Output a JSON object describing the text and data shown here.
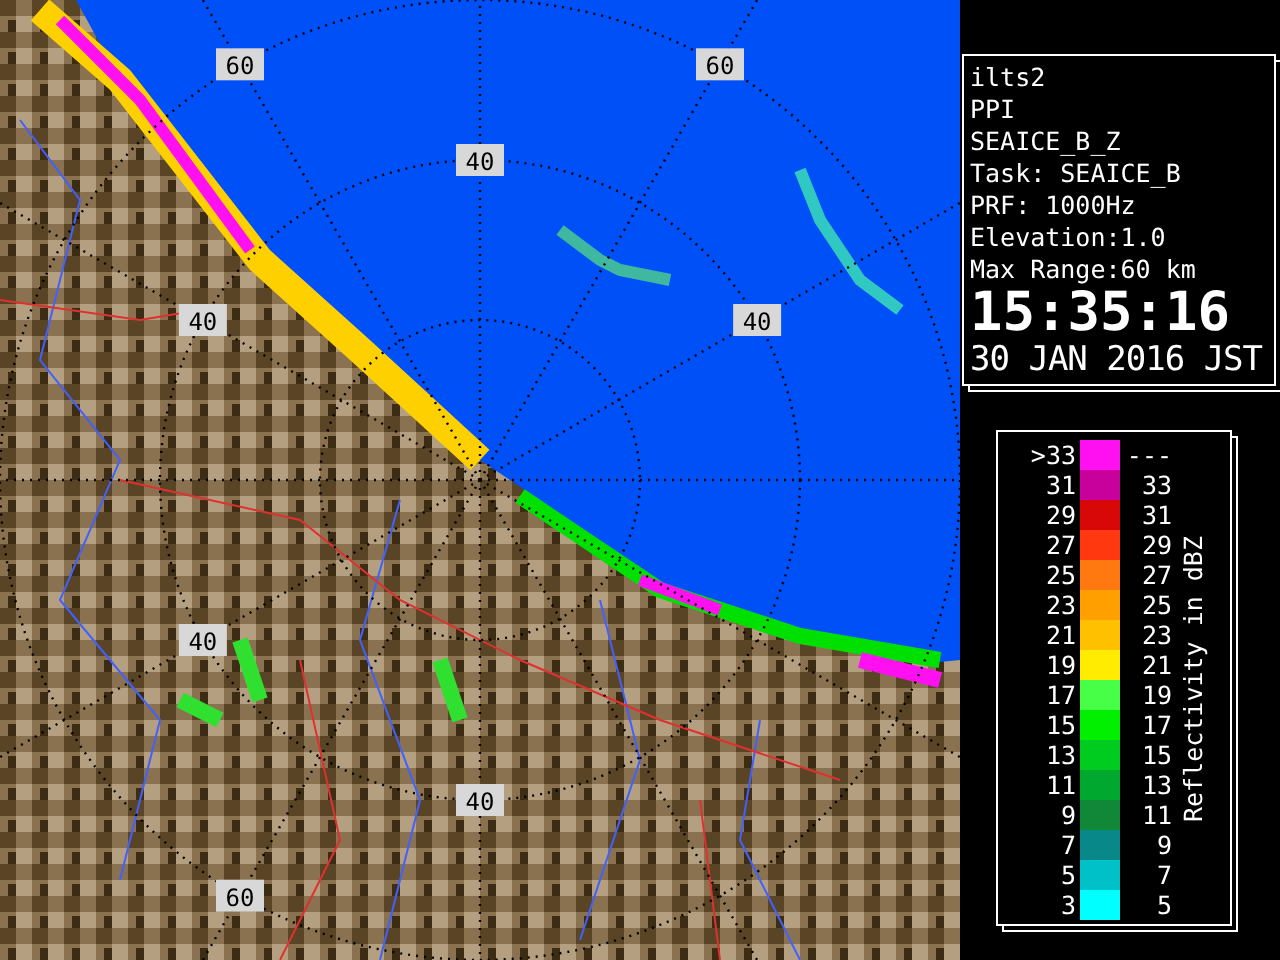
{
  "map": {
    "range_labels": [
      "60",
      "60",
      "40",
      "40",
      "40",
      "40",
      "40",
      "60"
    ]
  },
  "info": {
    "lines": [
      "ilts2",
      "PPI",
      "SEAICE_B_Z",
      "Task: SEAICE_B",
      "PRF: 1000Hz",
      "Elevation:1.0",
      "Max Range:60 km"
    ],
    "time": "15:35:16",
    "date": "30 JAN 2016 JST"
  },
  "legend": {
    "title": "Reflectivity in dBZ",
    "rows": [
      {
        "low": ">33",
        "high": "---",
        "color": "#ff10f0"
      },
      {
        "low": "31",
        "high": "33",
        "color": "#c8009c"
      },
      {
        "low": "29",
        "high": "31",
        "color": "#d80808"
      },
      {
        "low": "27",
        "high": "29",
        "color": "#ff3810"
      },
      {
        "low": "25",
        "high": "27",
        "color": "#ff7810"
      },
      {
        "low": "23",
        "high": "25",
        "color": "#ffa000"
      },
      {
        "low": "21",
        "high": "23",
        "color": "#ffc000"
      },
      {
        "low": "19",
        "high": "21",
        "color": "#ffec00"
      },
      {
        "low": "17",
        "high": "19",
        "color": "#48ff48"
      },
      {
        "low": "15",
        "high": "17",
        "color": "#00f000"
      },
      {
        "low": "13",
        "high": "15",
        "color": "#00cc20"
      },
      {
        "low": "11",
        "high": "13",
        "color": "#00a830"
      },
      {
        "low": "9",
        "high": "11",
        "color": "#108838"
      },
      {
        "low": "7",
        "high": "9",
        "color": "#088888"
      },
      {
        "low": "5",
        "high": "7",
        "color": "#00c0c8"
      },
      {
        "low": "3",
        "high": "5",
        "color": "#00ffff"
      }
    ]
  }
}
